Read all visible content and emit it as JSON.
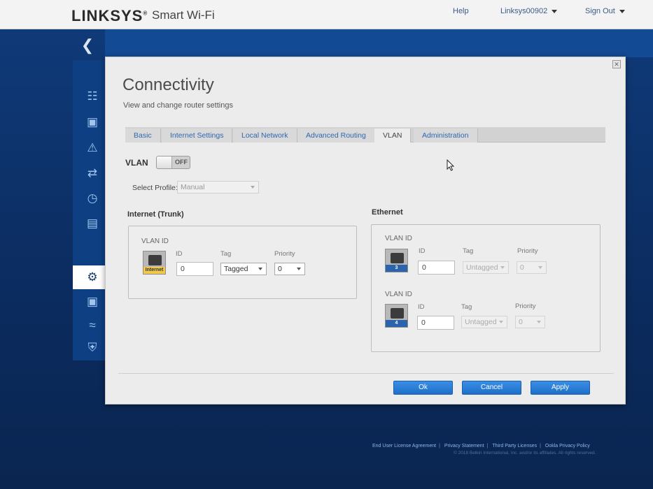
{
  "header": {
    "logo": "LINKSYS",
    "logo_trademark": "®",
    "product": "Smart Wi-Fi",
    "help": "Help",
    "user": "Linksys00902",
    "sign_out": "Sign Out"
  },
  "dialog": {
    "title": "Connectivity",
    "subtitle": "View and change router settings",
    "tabs": [
      {
        "label": "Basic"
      },
      {
        "label": "Internet Settings"
      },
      {
        "label": "Local Network"
      },
      {
        "label": "Advanced Routing"
      },
      {
        "label": "VLAN"
      },
      {
        "label": "Administration"
      }
    ],
    "active_tab": "VLAN",
    "vlan": {
      "label": "VLAN",
      "toggle_state": "OFF"
    },
    "profile": {
      "label": "Select Profile:",
      "value": "Manual"
    },
    "internet": {
      "title": "Internet (Trunk)",
      "vlan_id_label": "VLAN ID",
      "port_label": "Internet",
      "id_label": "ID",
      "tag_label": "Tag",
      "priority_label": "Priority",
      "id_value": "0",
      "tag_value": "Tagged",
      "priority_value": "0"
    },
    "ethernet": {
      "title": "Ethernet",
      "rows": [
        {
          "vlan_id_label": "VLAN ID",
          "port_label": "3",
          "id_label": "ID",
          "tag_label": "Tag",
          "priority_label": "Priority",
          "id_value": "0",
          "tag_value": "Untagged",
          "priority_value": "0"
        },
        {
          "vlan_id_label": "VLAN ID",
          "port_label": "4",
          "id_label": "ID",
          "tag_label": "Tag",
          "priority_label": "Priority",
          "id_value": "0",
          "tag_value": "Untagged",
          "priority_value": "0"
        }
      ]
    },
    "buttons": {
      "ok": "Ok",
      "cancel": "Cancel",
      "apply": "Apply"
    }
  },
  "footer": {
    "links": [
      "End User License Agreement",
      "Privacy Statement",
      "Third Party Licenses",
      "Ookla Privacy Policy"
    ],
    "copyright": "© 2018 Belkin International, Inc. and/or its affiliates. All rights reserved."
  },
  "icons": {
    "back": "chevron-left-icon",
    "sidebar": [
      "router-icon",
      "devices-icon",
      "warning-icon",
      "network-map-icon",
      "speed-icon",
      "external-storage-icon",
      "connectivity-gear-icon",
      "camera-icon",
      "wifi-icon",
      "security-icon"
    ]
  },
  "colors": {
    "accent": "#1f6fc9",
    "tab_link": "#2e67b1",
    "background": "#0d2f66"
  }
}
